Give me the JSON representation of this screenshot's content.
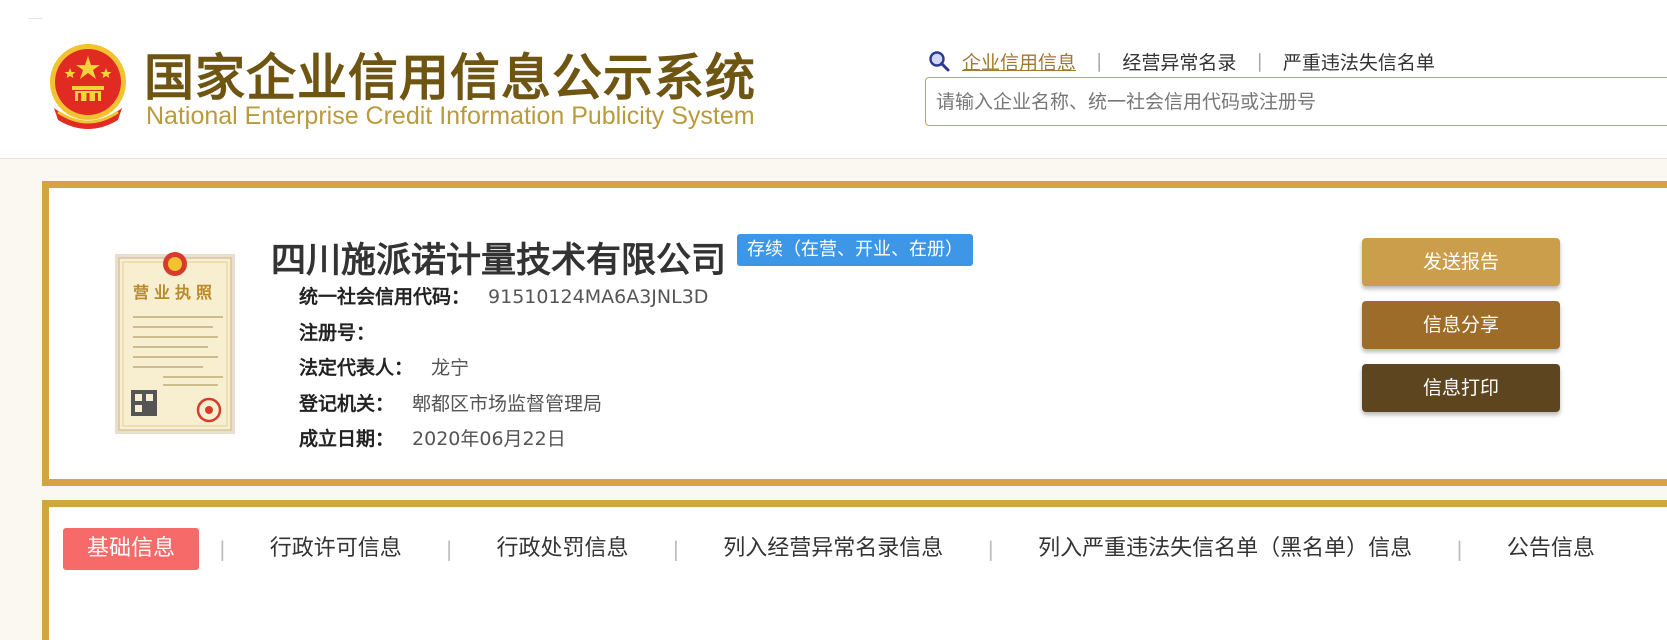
{
  "header": {
    "title_cn": "国家企业信用信息公示系统",
    "title_en": "National Enterprise Credit Information Publicity System",
    "links": [
      "企业信用信息",
      "经营异常名录",
      "严重违法失信名单"
    ],
    "search_placeholder": "请输入企业名称、统一社会信用代码或注册号"
  },
  "company": {
    "name": "四川施派诺计量技术有限公司",
    "status": "存续（在营、开业、在册）",
    "license_label": "营业执照",
    "fields": [
      {
        "label": "统一社会信用代码：",
        "value": "91510124MA6A3JNL3D"
      },
      {
        "label": "注册号：",
        "value": ""
      },
      {
        "label": "法定代表人：",
        "value": "龙宁"
      },
      {
        "label": "登记机关：",
        "value": "郫都区市场监督管理局"
      },
      {
        "label": "成立日期：",
        "value": "2020年06月22日"
      }
    ]
  },
  "actions": {
    "send": "发送报告",
    "share": "信息分享",
    "print": "信息打印"
  },
  "tabs": [
    "基础信息",
    "行政许可信息",
    "行政处罚信息",
    "列入经营异常名录信息",
    "列入严重违法失信名单（黑名单）信息",
    "公告信息"
  ],
  "colors": {
    "brand_gold": "#d3a441",
    "title_brown": "#6e5512",
    "status_blue": "#3e97e6",
    "active_tab": "#f76a6a",
    "btn_send": "#cb9e4c",
    "btn_share": "#9d6c28",
    "btn_print": "#5d4520"
  },
  "icons": [
    "national-emblem-icon",
    "search-icon",
    "business-license-icon"
  ]
}
